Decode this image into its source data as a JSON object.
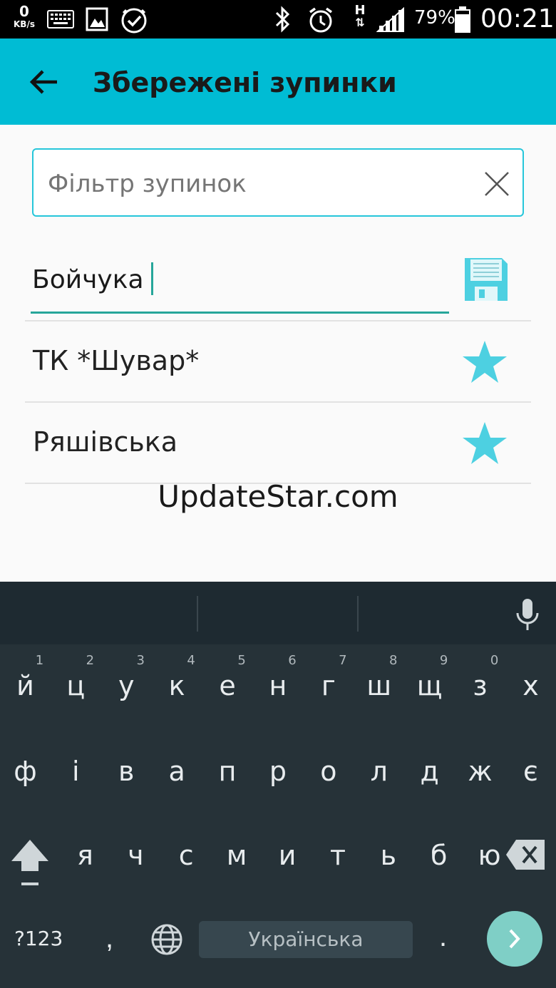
{
  "status_bar": {
    "net_speed_value": "0",
    "net_speed_unit": "KB/s",
    "battery_percent": "79%",
    "time": "00:21",
    "network_type": "H"
  },
  "app_bar": {
    "title": "Збережені зупинки"
  },
  "filter": {
    "placeholder": "Фільтр зупинок",
    "value": ""
  },
  "new_stop": {
    "value": "Бойчука"
  },
  "saved_stops": [
    {
      "name": "ТК *Шувар*",
      "favorite": true
    },
    {
      "name": "Ряшівська",
      "favorite": true
    }
  ],
  "watermark": "UpdateStar.com",
  "keyboard": {
    "row1": [
      {
        "hint": "1",
        "char": "й"
      },
      {
        "hint": "2",
        "char": "ц"
      },
      {
        "hint": "3",
        "char": "у"
      },
      {
        "hint": "4",
        "char": "к"
      },
      {
        "hint": "5",
        "char": "е"
      },
      {
        "hint": "6",
        "char": "н"
      },
      {
        "hint": "7",
        "char": "г"
      },
      {
        "hint": "8",
        "char": "ш"
      },
      {
        "hint": "9",
        "char": "щ"
      },
      {
        "hint": "0",
        "char": "з"
      },
      {
        "hint": "",
        "char": "х"
      }
    ],
    "row2": [
      "ф",
      "і",
      "в",
      "а",
      "п",
      "р",
      "о",
      "л",
      "д",
      "ж",
      "є"
    ],
    "row3": [
      "я",
      "ч",
      "с",
      "м",
      "и",
      "т",
      "ь",
      "б",
      "ю"
    ],
    "symbols_label": "?123",
    "comma": ",",
    "period": ".",
    "space_label": "Українська"
  },
  "colors": {
    "app_bar": "#00bcd4",
    "accent": "#26a69a",
    "star": "#4dd0e1",
    "keyboard_bg": "#263238"
  }
}
